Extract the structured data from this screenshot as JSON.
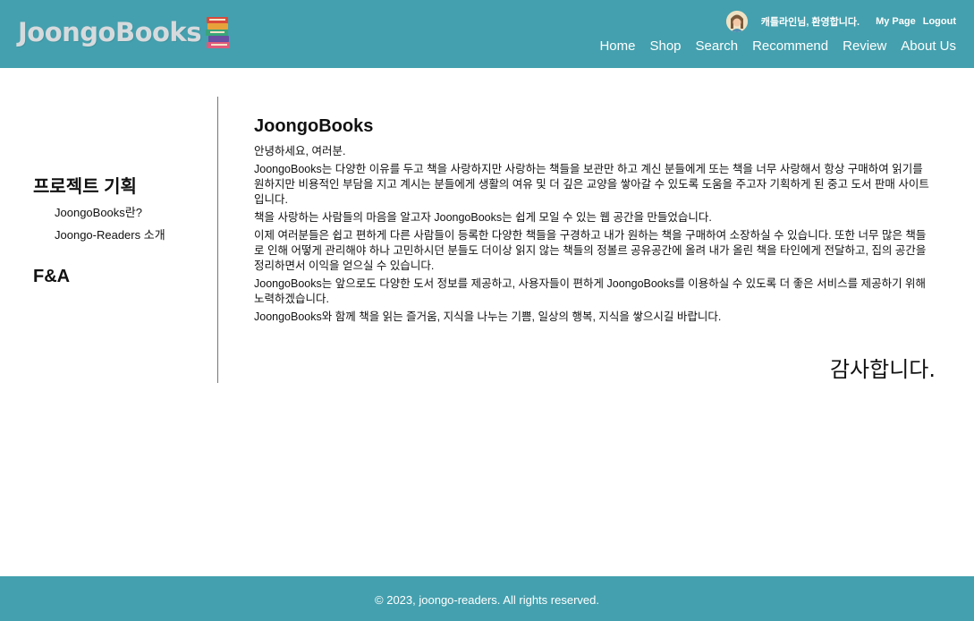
{
  "colors": {
    "teal": "#44a0ae"
  },
  "header": {
    "logo_text": "JoongoBooks",
    "logo_icon": "book-stack-icon",
    "user": {
      "welcome": "캐틀라인님, 환영합니다.",
      "links": [
        "My Page",
        "Logout"
      ]
    },
    "nav": [
      "Home",
      "Shop",
      "Search",
      "Recommend",
      "Review",
      "About Us"
    ]
  },
  "sidebar": {
    "section1": "프로젝트 기획",
    "links": [
      "JoongoBooks란?",
      "Joongo-Readers 소개"
    ],
    "section2": "F&A"
  },
  "main": {
    "title": "JoongoBooks",
    "paragraphs": [
      "안녕하세요, 여러분.",
      "JoongoBooks는 다양한 이유를 두고 책을 사랑하지만 사랑하는 책들을 보관만 하고 계신 분들에게 또는 책을 너무 사랑해서 항상 구매하여 읽기를 원하지만 비용적인 부담을 지고 계시는 분들에게 생활의 여유 및 더 깊은 교양을 쌓아갈 수 있도록 도움을 주고자 기획하게 된 중고 도서 판매 사이트 입니다.",
      "책을 사랑하는 사람들의 마음을 알고자 JoongoBooks는 쉽게 모일 수 있는 웹 공간을 만들었습니다.",
      "이제 여러분들은 쉽고 편하게 다른 사람들이 등록한 다양한 책들을 구경하고 내가 원하는 책을 구매하여 소장하실 수 있습니다. 또한 너무 많은 책들로 인해 어떻게 관리해야 하나 고민하시던 분들도 더이상 읽지 않는 책들의 정볼르 공유공간에 올려 내가 올린 책을 타인에게 전달하고, 집의 공간을 정리하면서 이익을 얻으실 수 있습니다.",
      "JoongoBooks는 앞으로도 다양한 도서 정보를 제공하고, 사용자들이 편하게 JoongoBooks를 이용하실 수 있도록 더 좋은 서비스를 제공하기 위해 노력하겠습니다.",
      "JoongoBooks와 함께 책을 읽는 즐거움, 지식을 나누는 기쁨, 일상의 행복, 지식을 쌓으시길 바랍니다."
    ],
    "thanks": "감사합니다."
  },
  "footer": {
    "copyright": "© 2023, joongo-readers. All rights reserved."
  }
}
